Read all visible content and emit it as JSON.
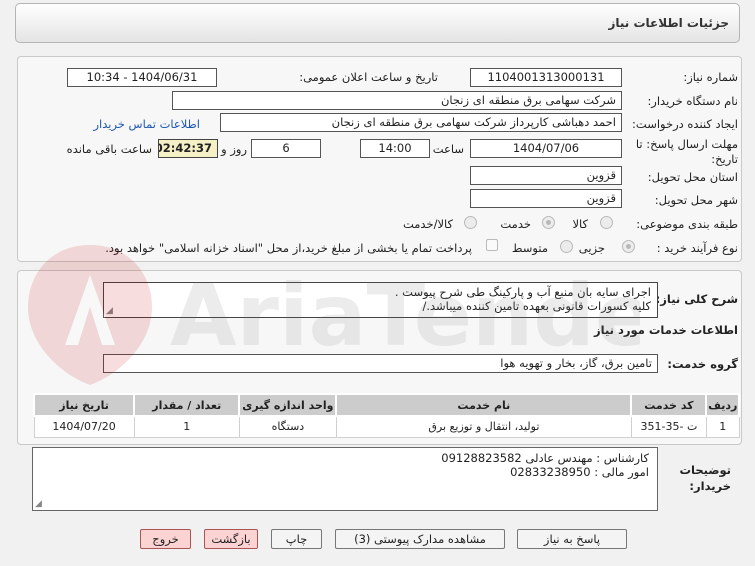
{
  "header": {
    "title": "جزئیات اطلاعات نیاز"
  },
  "form": {
    "need_number_label": "شماره نیاز:",
    "need_number": "1104001313000131",
    "announce_label": "تاریخ و ساعت اعلان عمومی:",
    "announce_value": "1404/06/31 - 10:34",
    "buyer_org_label": "نام دستگاه خریدار:",
    "buyer_org": "شرکت سهامی برق منطقه ای زنجان",
    "creator_label": "ایجاد کننده درخواست:",
    "creator": "احمد دهباشی کارپرداز شرکت سهامی برق منطقه ای زنجان",
    "contact_link": "اطلاعات تماس خریدار",
    "deadline_label_1": "مهلت ارسال پاسخ: تا",
    "deadline_label_2": "تاریخ:",
    "deadline_date": "1404/07/06",
    "time_label": "ساعت",
    "deadline_time": "14:00",
    "days_value": "6",
    "days_label": "روز و",
    "remaining_time": "02:42:37",
    "remaining_label": "ساعت باقی مانده",
    "province_label": "استان محل تحویل:",
    "province": "قزوین",
    "city_label": "شهر محل تحویل:",
    "city": "قزوین",
    "category_label": "طبقه بندی موضوعی:",
    "category_options": [
      "کالا",
      "خدمت",
      "کالا/خدمت"
    ],
    "process_label": "نوع فرآیند خرید :",
    "process_options": [
      "جزیی",
      "متوسط"
    ],
    "payment_note": "پرداخت تمام یا بخشی از مبلغ خرید،از محل \"اسناد خزانه اسلامی\" خواهد بود."
  },
  "description": {
    "label": "شرح کلی نیاز:",
    "lines": [
      "اجرای سایه بان منبع آب و پارکینگ طی شرح پیوست .",
      "کلیه کسورات قانونی بعهده تامین کننده میباشد./"
    ]
  },
  "services": {
    "section_title": "اطلاعات خدمات مورد نیاز",
    "group_label": "گروه خدمت:",
    "group_value": "تامین برق، گاز، بخار و تهویه هوا",
    "columns": [
      "ردیف",
      "کد خدمت",
      "نام خدمت",
      "واحد اندازه گیری",
      "تعداد / مقدار",
      "تاریخ نیاز"
    ],
    "rows": [
      [
        "1",
        "ت -35-351",
        "تولید، انتقال و توزیع برق",
        "دستگاه",
        "1",
        "1404/07/20"
      ]
    ]
  },
  "buyer_notes": {
    "label_1": "توضیحات",
    "label_2": "خریدار:",
    "lines": [
      "کارشناس : مهندس عادلی 09128823582",
      "امور مالی : 02833238950"
    ]
  },
  "buttons": {
    "reply": "پاسخ به نیاز",
    "attachments": "مشاهده مدارک پیوستی (3)",
    "print": "چاپ",
    "back": "بازگشت",
    "exit": "خروج"
  },
  "colors": {
    "link": "#1d57b5",
    "timer_bg": "#f5f0c6",
    "table_header": "#cccccc",
    "danger_button": "#fbd3d3"
  },
  "watermark": {
    "text": "AriaTender.net"
  }
}
